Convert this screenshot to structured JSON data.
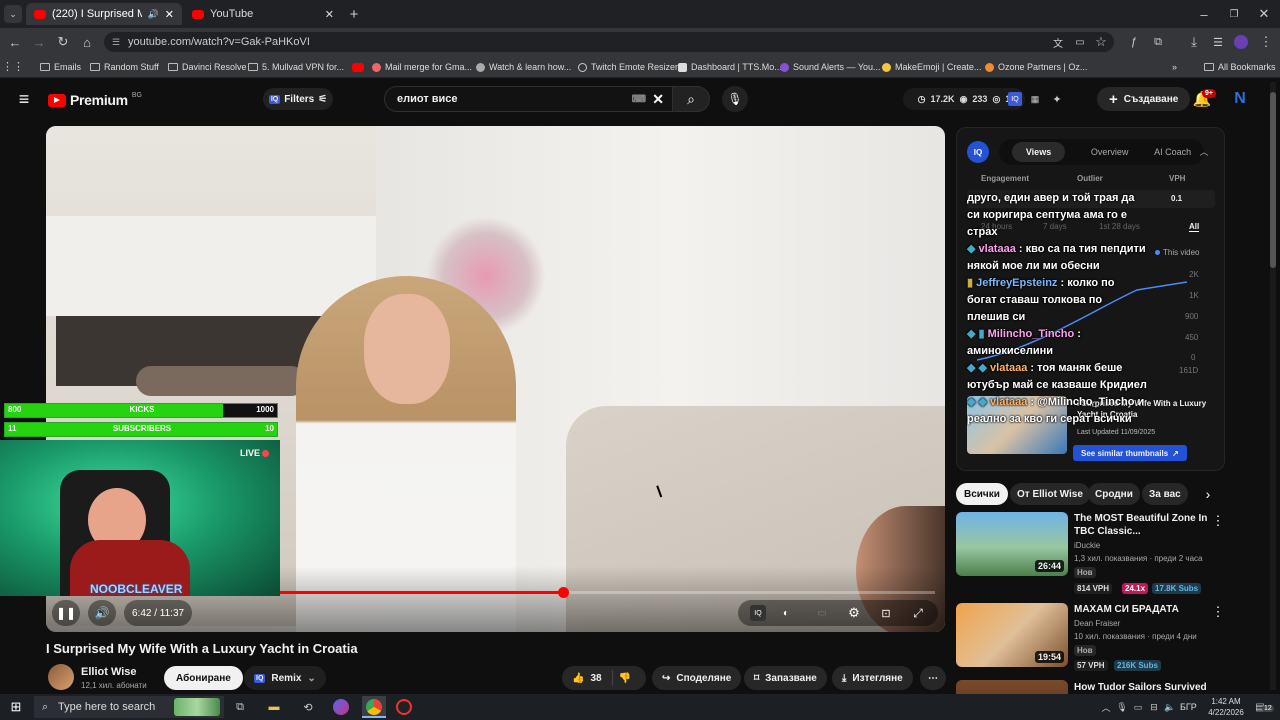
{
  "browser": {
    "tabs": [
      {
        "title": "(220) I Surprised My Wife W",
        "active": true
      },
      {
        "title": "YouTube",
        "active": false
      }
    ],
    "url": "youtube.com/watch?v=Gak-PaHKoVI",
    "bookmarks": [
      "Emails",
      "Random Stuff",
      "Davinci Resolve",
      "5. Mullvad VPN for...",
      "Mail merge for Gma...",
      "Watch & learn how...",
      "Twitch Emote Resizer",
      "Dashboard | TTS.Mo...",
      "Sound Alerts — You...",
      "MakeEmoji | Create...",
      "Ozone Partners | Oz..."
    ],
    "all_bookmarks": "All Bookmarks"
  },
  "masthead": {
    "logo": "Premium",
    "country": "BG",
    "filters_label": "Filters",
    "search_value": "елиот висе",
    "stats": {
      "views": "17.2K",
      "likes": "233",
      "live": "1"
    },
    "create_label": "Създаване",
    "notif_count": "9+",
    "avatar_letter": "N"
  },
  "overlay": {
    "kicks_current": "800",
    "kicks_label": "KICKS",
    "kicks_goal": "1000",
    "kicks_progress": 0.8,
    "subs_current": "11",
    "subs_label": "SUBSCRIBERS",
    "subs_goal": "10",
    "subs_progress": 1.0,
    "live_label": "LIVE",
    "streamer_name": "NOOBCLEAVER"
  },
  "player": {
    "time": "6:42 / 11:37",
    "progress": 0.577
  },
  "video": {
    "title": "I Surprised My Wife With a Luxury Yacht in Croatia",
    "channel": "Elliot Wise",
    "subscribers": "12,1 хил. абонати",
    "subscribe_label": "Абониране",
    "remix_label": "Remix",
    "likes": "38",
    "share_label": "Споделяне",
    "save_label": "Запазване",
    "download_label": "Изтегляне"
  },
  "vidiq": {
    "badge": "IQ",
    "tabs": [
      "Views",
      "Overview",
      "AI Coach"
    ],
    "metric_headers": [
      "Engagement",
      "Outlier",
      "VPH"
    ],
    "vph_value": "0.1",
    "ranges": [
      "24 hours",
      "7 days",
      "1st 28 days",
      "All"
    ],
    "legend": "This video",
    "y_ticks": [
      "2K",
      "1K",
      "900",
      "450",
      "0"
    ],
    "x_end": "161D",
    "thumb_title": "I Surprised My Wife With a Luxury Yacht in Croatia",
    "last_updated": "Last Updated 11/09/2025",
    "similar_label": "See similar thumbnails"
  },
  "chat": [
    {
      "user": "",
      "text": "друго, един авер и той трая да си коригира септума ама го е страх"
    },
    {
      "user": "vlataaa",
      "text": ": кво са па тия пепдити някой мое ли ми обесни"
    },
    {
      "user": "JeffreyEpsteinz",
      "text": ": колко по богат ставаш толкова по плешив си"
    },
    {
      "user": "Milincho_Tincho",
      "text": ": аминокиселини"
    },
    {
      "user": "vlataaa",
      "text": ": тоя маняк беше ютубър май се казваше Кридиел"
    },
    {
      "user": "vlataaa",
      "text": ": @Milincho_Tincho и реално за кво ги серат всички"
    }
  ],
  "chips": [
    "Всички",
    "От Elliot Wise",
    "Сродни",
    "За вас"
  ],
  "related": [
    {
      "title": "The MOST Beautiful Zone In TBC Classic...",
      "channel": "iDuckie",
      "meta": "1,3 хил. показвания · преди 2 часа",
      "new": "Нов",
      "duration": "26:44",
      "vph": "814 VPH",
      "outlier": "24.1x",
      "subs": "17.8K Subs"
    },
    {
      "title": "МАХАМ СИ БРАДАТА",
      "channel": "Dean Fraiser",
      "meta": "10 хил. показвания · преди 4 дни",
      "new": "Нов",
      "duration": "19:54",
      "vph": "57 VPH",
      "outlier": "",
      "subs": "216K Subs"
    },
    {
      "title": "How Tudor Sailors Survived a 7",
      "channel": "",
      "meta": "",
      "new": "",
      "duration": "",
      "vph": "",
      "outlier": "",
      "subs": ""
    }
  ],
  "taskbar": {
    "search_placeholder": "Type here to search",
    "lang": "БГР",
    "time": "1:42 AM",
    "date": "4/22/2026",
    "notif": "12"
  }
}
